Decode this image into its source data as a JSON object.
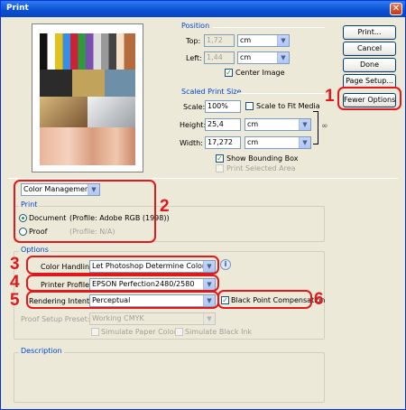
{
  "window": {
    "title": "Print",
    "close_glyph": "✕"
  },
  "position": {
    "title": "Position",
    "top_label": "Top:",
    "top_value": "1,72",
    "top_unit": "cm",
    "left_label": "Left:",
    "left_value": "1,44",
    "left_unit": "cm",
    "center_label": "Center Image",
    "center_checked": true
  },
  "scaled": {
    "title": "Scaled Print Size",
    "scale_label": "Scale:",
    "scale_value": "100%",
    "scale_to_fit_label": "Scale to Fit Media",
    "scale_to_fit_checked": false,
    "height_label": "Height:",
    "height_value": "25,4",
    "height_unit": "cm",
    "width_label": "Width:",
    "width_value": "17,272",
    "width_unit": "cm",
    "bounding_label": "Show Bounding Box",
    "bounding_checked": true,
    "print_selected_label": "Print Selected Area",
    "print_selected_checked": false
  },
  "buttons": {
    "print": "Print...",
    "cancel": "Cancel",
    "done": "Done",
    "page_setup": "Page Setup...",
    "fewer_options": "Fewer Options"
  },
  "mode_select": "Color Management",
  "print_group": {
    "title": "Print",
    "document_label": "Document",
    "document_profile": "(Profile: Adobe RGB (1998))",
    "proof_label": "Proof",
    "proof_profile": "(Profile: N/A)",
    "selected": "Document"
  },
  "options": {
    "title": "Options",
    "color_handling_label": "Color Handling:",
    "color_handling_value": "Let Photoshop Determine Colors",
    "printer_profile_label": "Printer Profile:",
    "printer_profile_value": "EPSON Perfection2480/2580",
    "rendering_intent_label": "Rendering Intent:",
    "rendering_intent_value": "Perceptual",
    "black_point_label": "Black Point Compensation",
    "black_point_checked": true,
    "proof_setup_label": "Proof Setup Preset:",
    "proof_setup_value": "Working CMYK",
    "simulate_paper_label": "Simulate Paper Color",
    "simulate_ink_label": "Simulate Black Ink"
  },
  "description": {
    "title": "Description"
  },
  "annotations": {
    "n1": "1",
    "n2": "2",
    "n3": "3",
    "n4": "4",
    "n5": "5",
    "n6": "6"
  },
  "icons": {
    "info": "info-icon",
    "link": "link-icon",
    "dropdown": "dropdown-arrow-icon",
    "check": "✓"
  },
  "colors": {
    "annotation_red": "#e0191c",
    "group_title_blue": "#0046d5",
    "title_bar_blue": "#0a4fd1"
  }
}
